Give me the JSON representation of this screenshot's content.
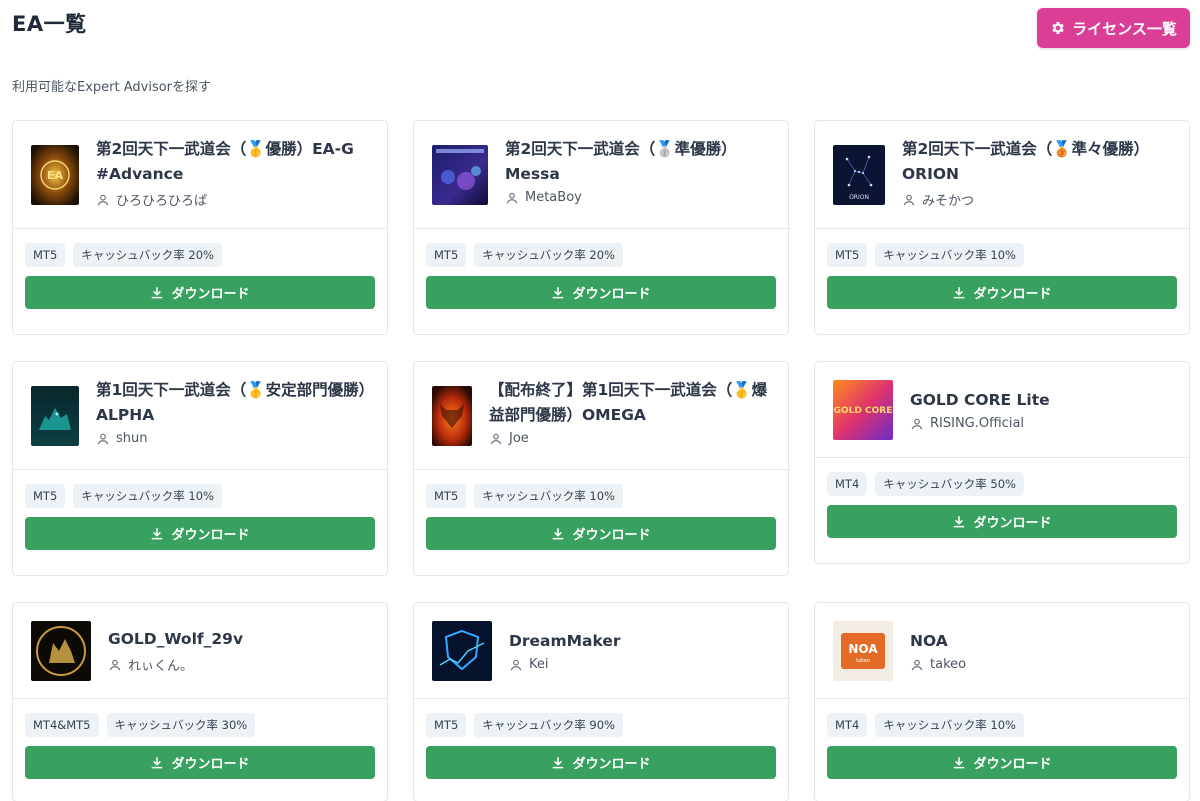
{
  "header": {
    "title": "EA一覧",
    "license_button_label": "ライセンス一覧",
    "subtitle": "利用可能なExpert Advisorを探す"
  },
  "colors": {
    "accent_pink": "#db3f95",
    "download_green": "#38a160",
    "tag_bg": "#edf2f7"
  },
  "download_label": "ダウンロード",
  "cards": [
    {
      "name": "第2回天下一武道会（🥇優勝）EA-G #Advance",
      "author": "ひろひろひろぱ",
      "platform": "MT5",
      "cashback": "キャッシュバック率 20%",
      "thumb_icon": "eag-gold-logo"
    },
    {
      "name": "第2回天下一武道会（🥈準優勝）Messa",
      "author": "MetaBoy",
      "platform": "MT5",
      "cashback": "キャッシュバック率 20%",
      "thumb_icon": "messa-cover"
    },
    {
      "name": "第2回天下一武道会（🥉準々優勝）ORION",
      "author": "みそかつ",
      "platform": "MT5",
      "cashback": "キャッシュバック率 10%",
      "thumb_icon": "orion-constellation",
      "thumb_text": "ORION"
    },
    {
      "name": "第1回天下一武道会（🥇安定部門優勝）ALPHA",
      "author": "shun",
      "platform": "MT5",
      "cashback": "キャッシュバック率 10%",
      "thumb_icon": "alpha-wolf"
    },
    {
      "name": "【配布終了】第1回天下一武道会（🥇爆益部門優勝）OMEGA",
      "author": "Joe",
      "platform": "MT5",
      "cashback": "キャッシュバック率 10%",
      "thumb_icon": "omega-bull"
    },
    {
      "name": "GOLD CORE Lite",
      "author": "RISING.Official",
      "platform": "MT4",
      "cashback": "キャッシュバック率 50%",
      "thumb_icon": "gold-core-logo",
      "thumb_text": "GOLD CORE"
    },
    {
      "name": "GOLD_Wolf_29v",
      "author": "れぃくん。",
      "platform": "MT4&MT5",
      "cashback": "キャッシュバック率 30%",
      "thumb_icon": "gold-wolf-emblem"
    },
    {
      "name": "DreamMaker",
      "author": "Kei",
      "platform": "MT5",
      "cashback": "キャッシュバック率 90%",
      "thumb_icon": "dreammaker-shield"
    },
    {
      "name": "NOA",
      "author": "takeo",
      "platform": "MT4",
      "cashback": "キャッシュバック率 10%",
      "thumb_icon": "noa-logo",
      "thumb_text": "NOA",
      "thumb_subtext": "takeo"
    }
  ]
}
